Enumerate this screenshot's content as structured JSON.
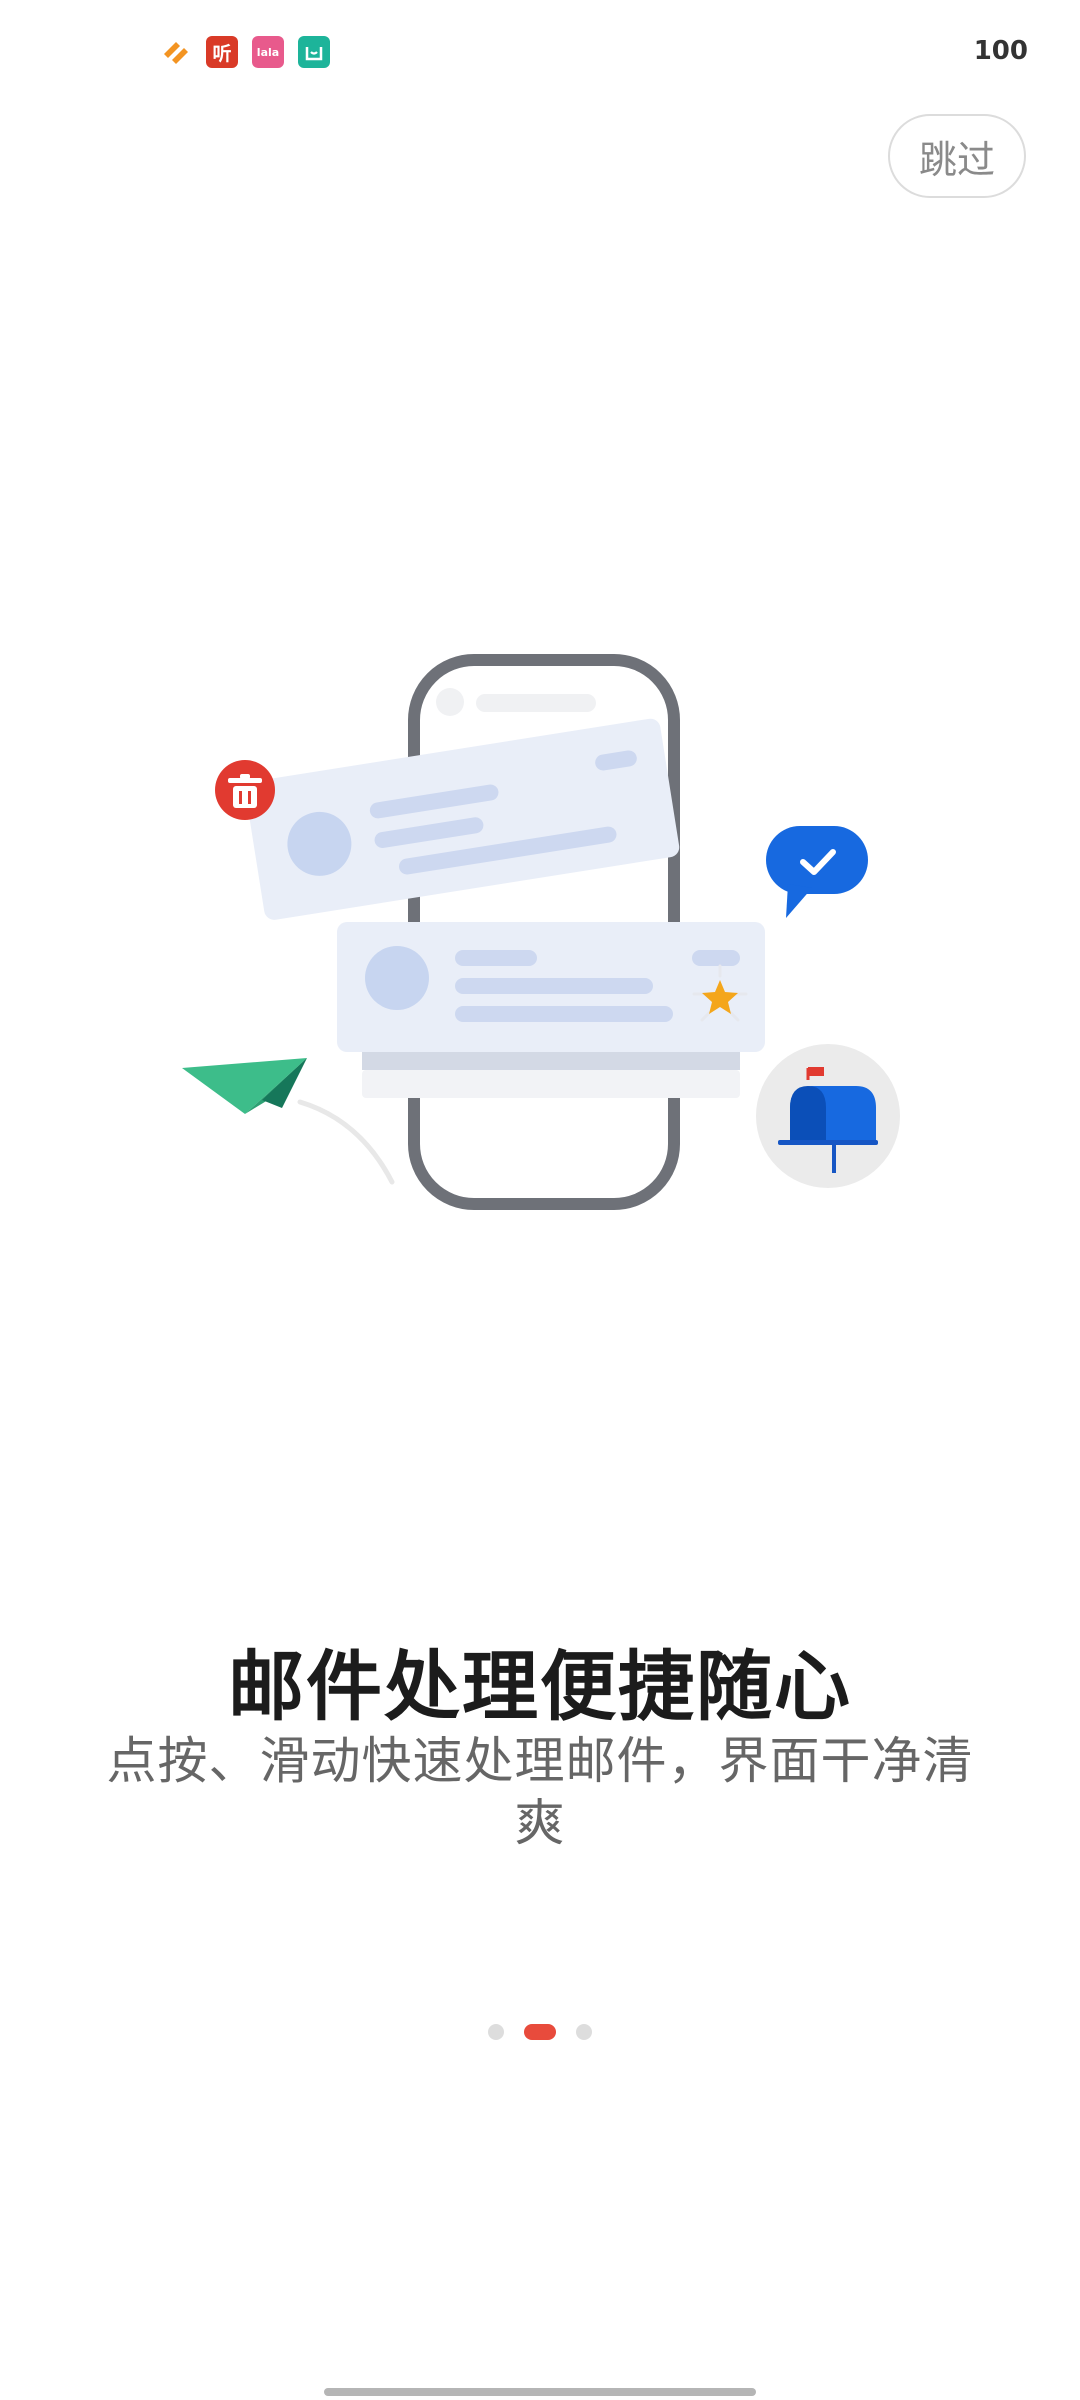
{
  "status_bar": {
    "app_icons": [
      {
        "name": "tag-app",
        "glyph": "",
        "color": "#f39422"
      },
      {
        "name": "listen-app",
        "glyph": "听",
        "color": "#d93a27"
      },
      {
        "name": "lala-app",
        "glyph": "lala",
        "color": "#e85a8c"
      },
      {
        "name": "home-app",
        "glyph": "",
        "color": "#1db49a"
      }
    ],
    "battery": "100"
  },
  "skip_button": {
    "label": "跳过"
  },
  "onboarding": {
    "title": "邮件处理便捷随心",
    "subtitle": "点按、滑动快速处理邮件，界面干净清爽"
  },
  "pager": {
    "total": 3,
    "current_index": 1
  },
  "colors": {
    "accent": "#e84b3c",
    "phone_frame": "#6e7178",
    "card_light": "#e9eef8",
    "card_line": "#cdd8f0",
    "blue": "#1769e0",
    "green": "#3dbd8a",
    "star": "#f4a61c"
  }
}
